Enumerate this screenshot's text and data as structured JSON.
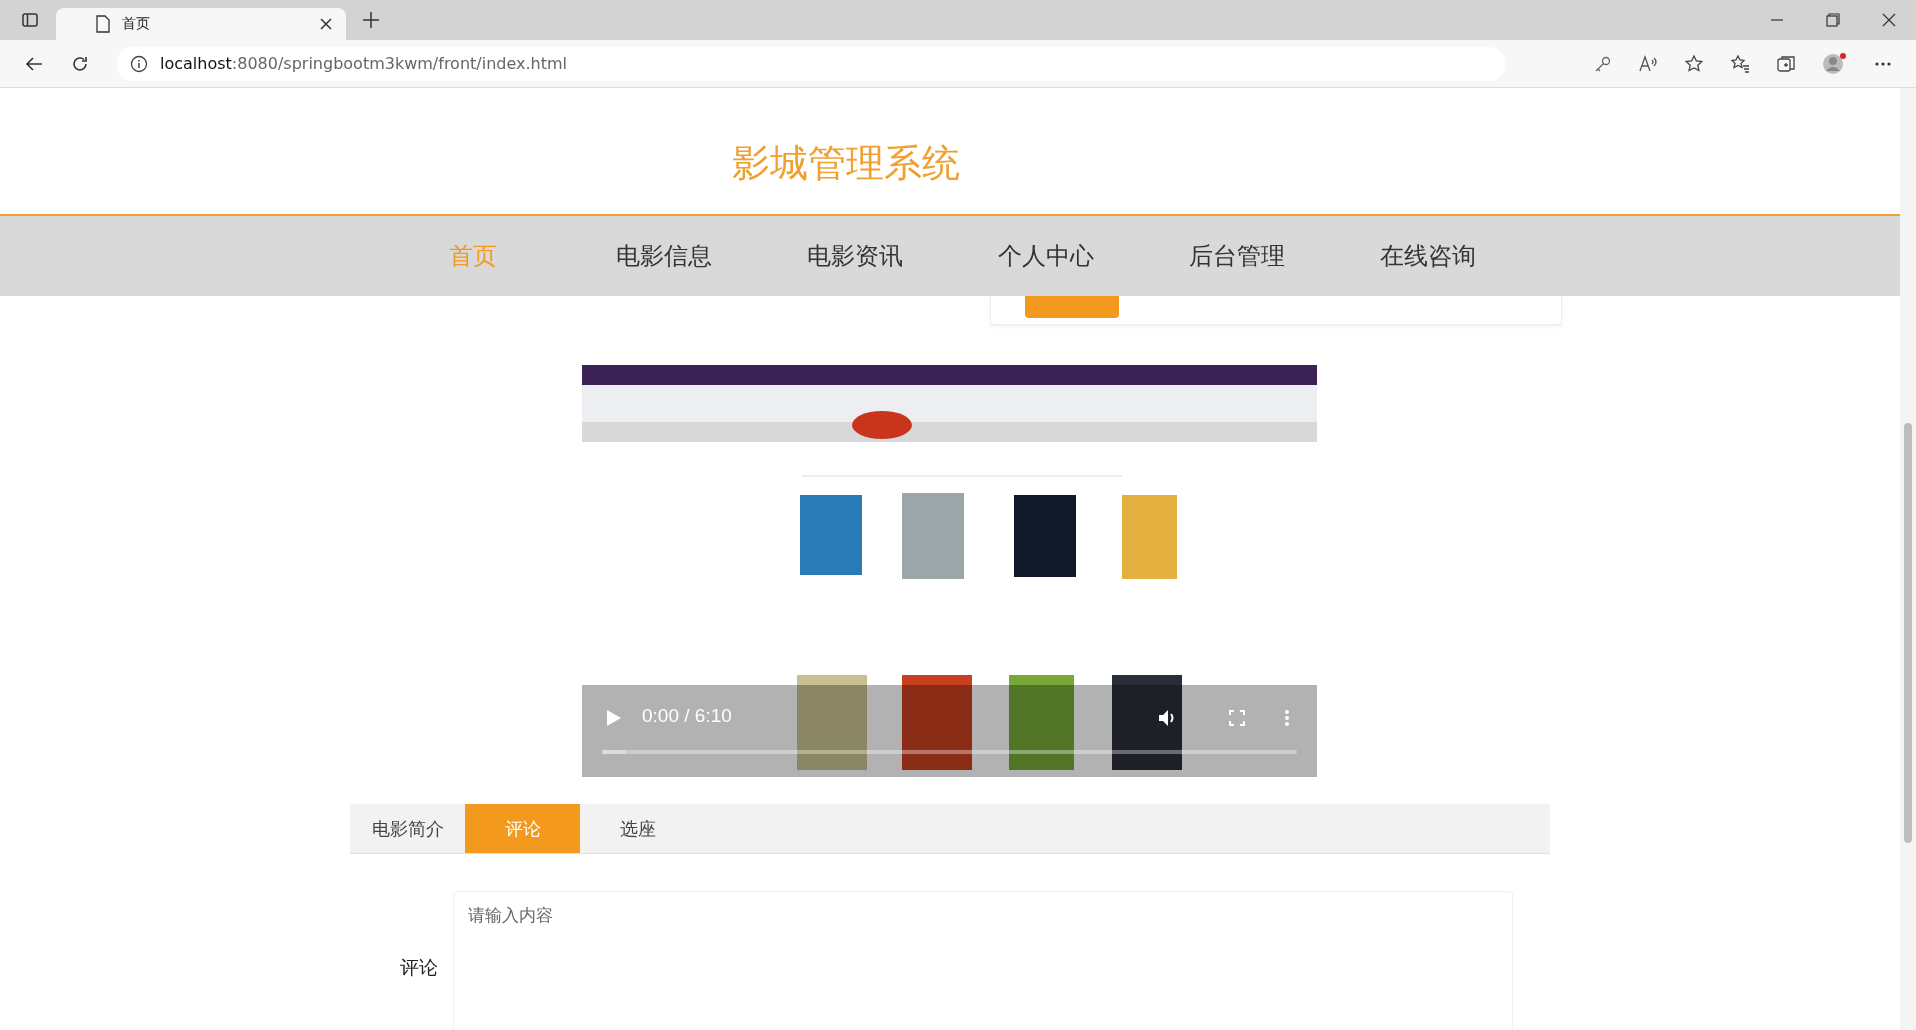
{
  "browser": {
    "tab_title": "首页",
    "address_host": "localhost",
    "address_path": ":8080/springbootm3kwm/front/index.html"
  },
  "site_title": "影城管理系统",
  "nav": [
    {
      "label": "首页",
      "selected": true
    },
    {
      "label": "电影信息",
      "selected": false
    },
    {
      "label": "电影资讯",
      "selected": false
    },
    {
      "label": "个人中心",
      "selected": false
    },
    {
      "label": "后台管理",
      "selected": false
    },
    {
      "label": "在线咨询",
      "selected": false
    }
  ],
  "video": {
    "time": "0:00 / 6:10",
    "level": 0.035
  },
  "detail_tabs": [
    {
      "label": "电影简介",
      "selected": false
    },
    {
      "label": "评论",
      "selected": true
    },
    {
      "label": "选座",
      "selected": false
    }
  ],
  "comment_form": {
    "label": "评论",
    "placeholder": "请输入内容"
  }
}
